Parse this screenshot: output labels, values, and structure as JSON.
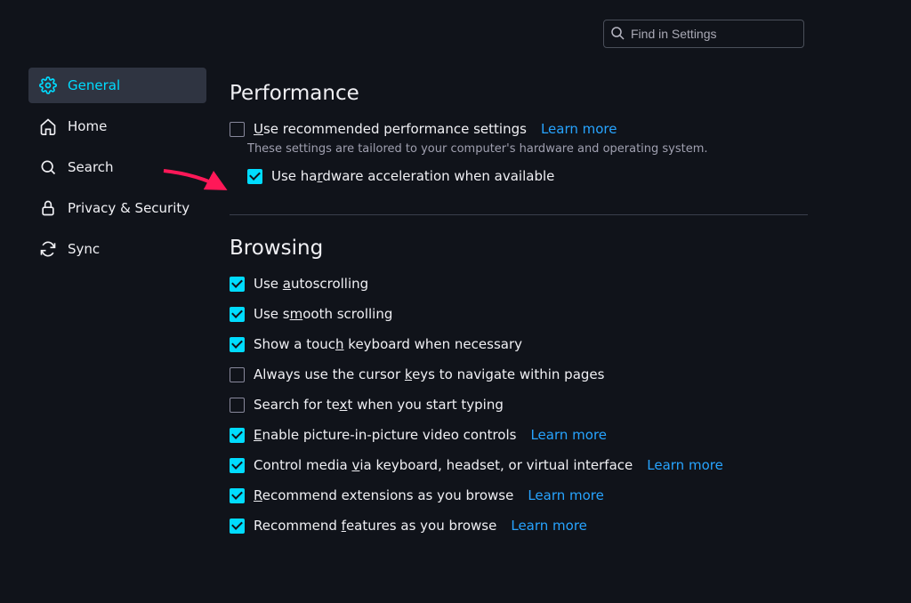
{
  "search": {
    "placeholder": "Find in Settings"
  },
  "sidebar": {
    "items": [
      {
        "label": "General"
      },
      {
        "label": "Home"
      },
      {
        "label": "Search"
      },
      {
        "label": "Privacy & Security"
      },
      {
        "label": "Sync"
      }
    ]
  },
  "performance": {
    "heading": "Performance",
    "rec_label_pre": "U",
    "rec_label_post": "se recommended performance settings",
    "rec_learn": "Learn more",
    "desc": "These settings are tailored to your computer's hardware and operating system.",
    "hw_label_pre": "Use ha",
    "hw_label_u": "r",
    "hw_label_post": "dware acceleration when available"
  },
  "browsing": {
    "heading": "Browsing",
    "items": [
      {
        "checked": true,
        "pre": "Use ",
        "u": "a",
        "post": "utoscrolling",
        "learn": ""
      },
      {
        "checked": true,
        "pre": "Use s",
        "u": "m",
        "post": "ooth scrolling",
        "learn": ""
      },
      {
        "checked": true,
        "pre": "Show a touc",
        "u": "h",
        "post": " keyboard when necessary",
        "learn": ""
      },
      {
        "checked": false,
        "pre": "Always use the cursor ",
        "u": "k",
        "post": "eys to navigate within pages",
        "learn": ""
      },
      {
        "checked": false,
        "pre": "Search for te",
        "u": "x",
        "post": "t when you start typing",
        "learn": ""
      },
      {
        "checked": true,
        "pre": "",
        "u": "E",
        "post": "nable picture-in-picture video controls",
        "learn": "Learn more"
      },
      {
        "checked": true,
        "pre": "Control media ",
        "u": "v",
        "post": "ia keyboard, headset, or virtual interface",
        "learn": "Learn more"
      },
      {
        "checked": true,
        "pre": "",
        "u": "R",
        "post": "ecommend extensions as you browse",
        "learn": "Learn more"
      },
      {
        "checked": true,
        "pre": "Recommend ",
        "u": "f",
        "post": "eatures as you browse",
        "learn": "Learn more"
      }
    ]
  }
}
